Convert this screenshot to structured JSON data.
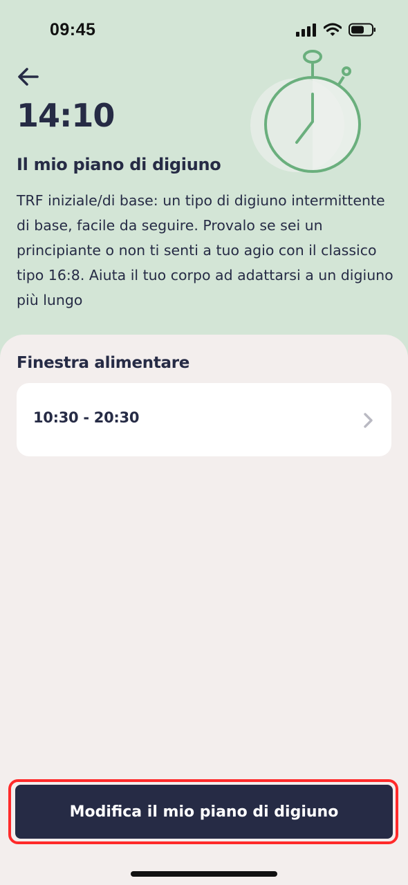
{
  "status_bar": {
    "time": "09:45"
  },
  "header": {
    "back_icon": "arrow-left-icon",
    "time_display": "14:10",
    "illustration": "stopwatch-icon"
  },
  "plan": {
    "title": "Il mio piano di digiuno",
    "description": "TRF iniziale/di base: un tipo di digiuno intermittente di base, facile da seguire. Provalo se sei un principiante o non ti senti a tuo agio con il classico tipo 16:8. Aiuta il tuo corpo ad adattarsi a un digiuno più lungo"
  },
  "eating_window": {
    "section_title": "Finestra alimentare",
    "value": "10:30 - 20:30",
    "chevron_icon": "chevron-right-icon"
  },
  "cta": {
    "label": "Modifica il mio piano di digiuno"
  },
  "colors": {
    "header_bg": "#d3e5d6",
    "page_bg": "#f3eeed",
    "primary_dark": "#262b45",
    "accent_green": "#6aaf7d",
    "highlight_red": "#ff2a2a"
  }
}
